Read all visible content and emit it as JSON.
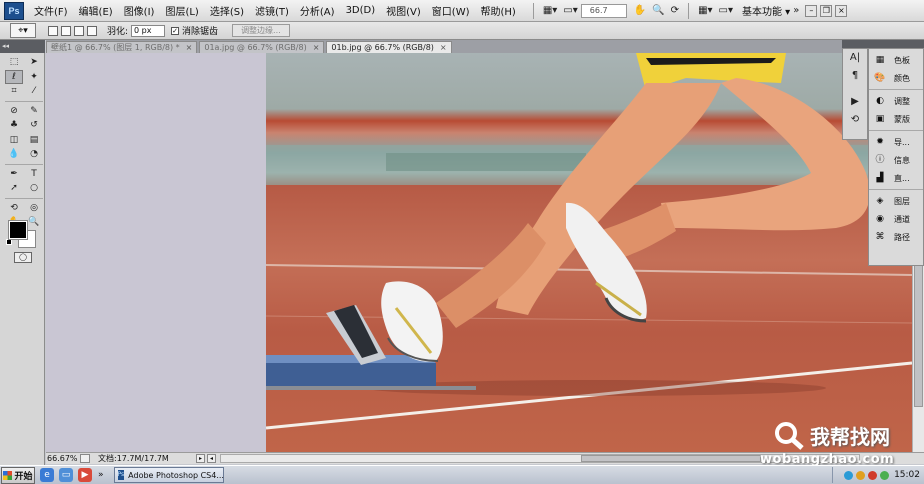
{
  "app": {
    "logo": "Ps"
  },
  "menu": {
    "items": [
      "文件(F)",
      "编辑(E)",
      "图像(I)",
      "图层(L)",
      "选择(S)",
      "滤镜(T)",
      "分析(A)",
      "3D(D)",
      "视图(V)",
      "窗口(W)",
      "帮助(H)"
    ],
    "zoom": "66.7",
    "workspace": "基本功能 ▾"
  },
  "options": {
    "feather_label": "羽化:",
    "feather_value": "0 px",
    "antialias_label": "消除锯齿",
    "refine_button": "调整边缘..."
  },
  "tabs": [
    {
      "label": "壁纸1 @ 66.7% (图层 1, RGB/8) *",
      "active": false
    },
    {
      "label": "01a.jpg @ 66.7% (RGB/8)",
      "active": false
    },
    {
      "label": "01b.jpg @ 66.7% (RGB/8)",
      "active": true
    }
  ],
  "panels": {
    "items": [
      "色板",
      "颜色",
      "调整",
      "蒙版",
      "导...",
      "信息",
      "直...",
      "图层",
      "通道",
      "路径"
    ]
  },
  "status": {
    "zoom": "66.67%",
    "docsize": "文档:17.7M/17.7M"
  },
  "watermark": {
    "text": "我帮找网",
    "url": "wobangzhao.com"
  },
  "taskbar": {
    "start": "开始",
    "task": "Adobe Photoshop CS4...",
    "clock": "15:02"
  },
  "colors": {
    "accent": "#1d4f8e",
    "track": "#c06549"
  }
}
